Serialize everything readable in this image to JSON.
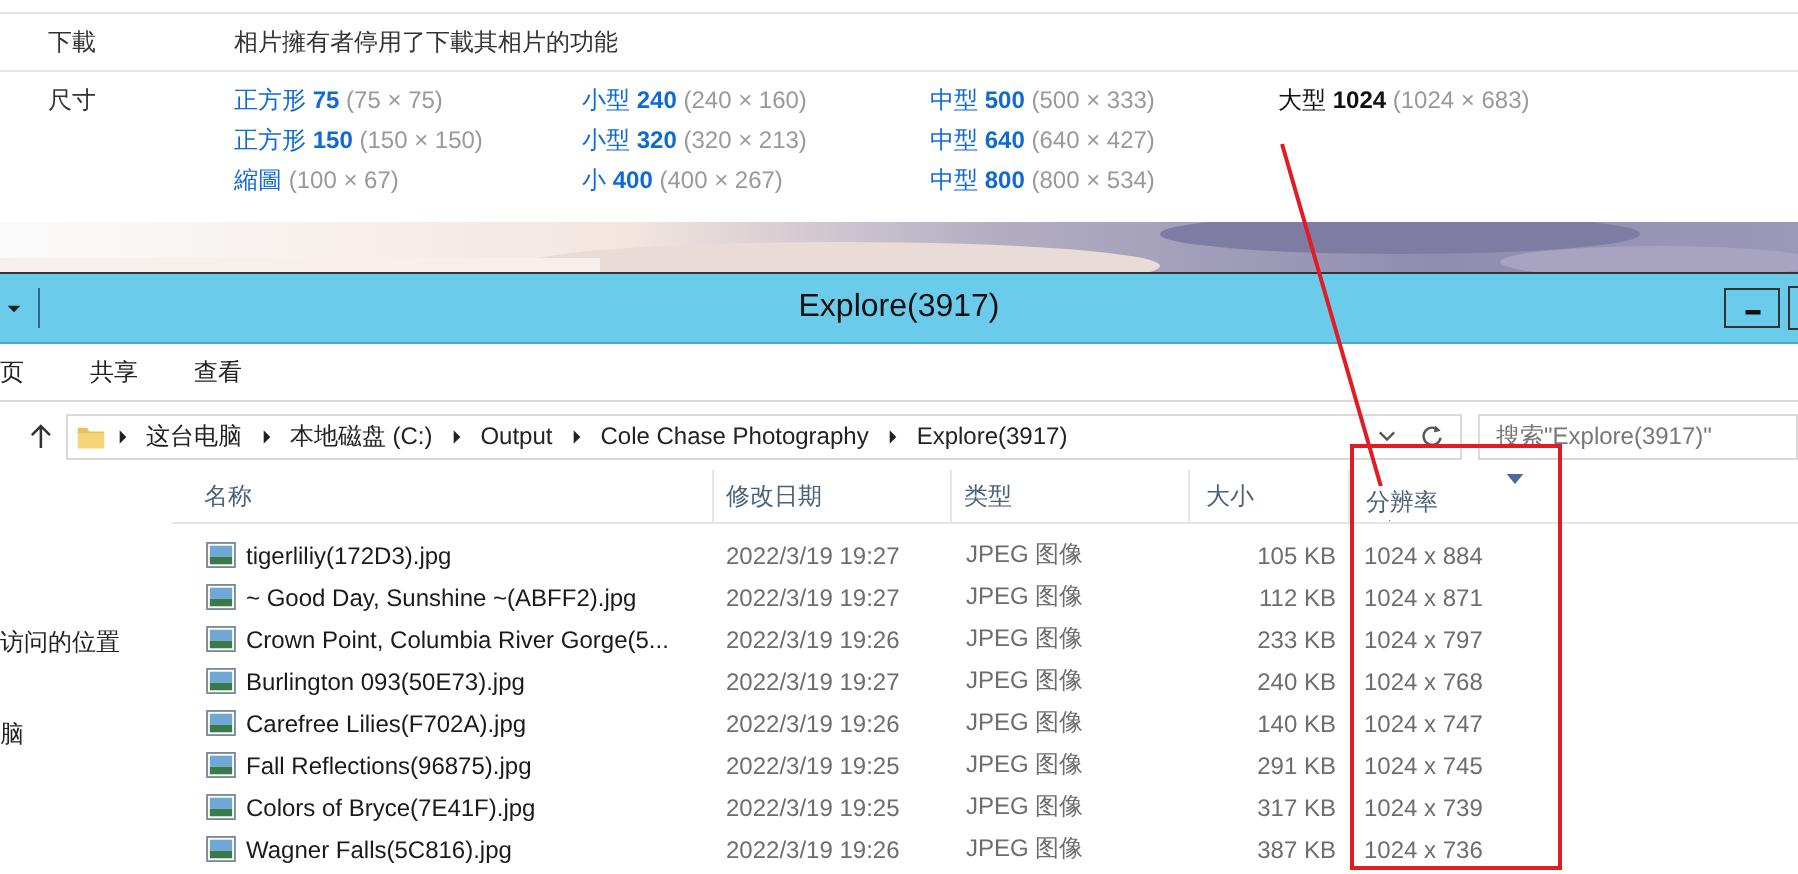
{
  "photo_page": {
    "download": {
      "label": "下載",
      "text": "相片擁有者停用了下載其相片的功能"
    },
    "sizes": {
      "label": "尺寸",
      "columns": [
        [
          {
            "name": "正方形 **75**",
            "dims": "(75 × 75)",
            "selected": false
          },
          {
            "name": "正方形 **150**",
            "dims": "(150 × 150)",
            "selected": false
          },
          {
            "name": "縮圖",
            "dims": "(100 × 67)",
            "selected": false
          }
        ],
        [
          {
            "name": "小型 **240**",
            "dims": "(240 × 160)",
            "selected": false
          },
          {
            "name": "小型 **320**",
            "dims": "(320 × 213)",
            "selected": false
          },
          {
            "name": "小 **400**",
            "dims": "(400 × 267)",
            "selected": false
          }
        ],
        [
          {
            "name": "中型 **500**",
            "dims": "(500 × 333)",
            "selected": false
          },
          {
            "name": "中型 **640**",
            "dims": "(640 × 427)",
            "selected": false
          },
          {
            "name": "中型 **800**",
            "dims": "(800 × 534)",
            "selected": false
          }
        ],
        [
          {
            "name": "大型 **1024**",
            "dims": "(1024 × 683)",
            "selected": true
          }
        ]
      ]
    }
  },
  "window": {
    "title": "Explore(3917)"
  },
  "ribbon_tabs": [
    {
      "label": "页"
    },
    {
      "label": "共享"
    },
    {
      "label": "查看"
    }
  ],
  "address": {
    "breadcrumbs": [
      "这台电脑",
      "本地磁盘 (C:)",
      "Output",
      "Cole Chase Photography",
      "Explore(3917)"
    ],
    "search_placeholder": "搜索\"Explore(3917)\""
  },
  "sidebar": {
    "items": [
      "访问的位置",
      "脑"
    ]
  },
  "table": {
    "columns": [
      {
        "label": "名称",
        "sorted": false
      },
      {
        "label": "修改日期",
        "sorted": false
      },
      {
        "label": "类型",
        "sorted": false
      },
      {
        "label": "大小",
        "sorted": false
      },
      {
        "label": "分辨率",
        "sorted": true
      }
    ],
    "rows": [
      [
        "tigerliliy(172D3).jpg",
        "2022/3/19 19:27",
        "JPEG 图像",
        "105 KB",
        "1024 x 884"
      ],
      [
        "~ Good Day, Sunshine ~(ABFF2).jpg",
        "2022/3/19 19:27",
        "JPEG 图像",
        "112 KB",
        "1024 x 871"
      ],
      [
        "Crown Point, Columbia River Gorge(5...",
        "2022/3/19 19:26",
        "JPEG 图像",
        "233 KB",
        "1024 x 797"
      ],
      [
        "Burlington 093(50E73).jpg",
        "2022/3/19 19:27",
        "JPEG 图像",
        "240 KB",
        "1024 x 768"
      ],
      [
        "Carefree Lilies(F702A).jpg",
        "2022/3/19 19:26",
        "JPEG 图像",
        "140 KB",
        "1024 x 747"
      ],
      [
        "Fall Reflections(96875).jpg",
        "2022/3/19 19:25",
        "JPEG 图像",
        "291 KB",
        "1024 x 745"
      ],
      [
        "Colors of Bryce(7E41F).jpg",
        "2022/3/19 19:25",
        "JPEG 图像",
        "317 KB",
        "1024 x 739"
      ],
      [
        "Wagner Falls(5C816).jpg",
        "2022/3/19 19:26",
        "JPEG 图像",
        "387 KB",
        "1024 x 736"
      ]
    ]
  }
}
